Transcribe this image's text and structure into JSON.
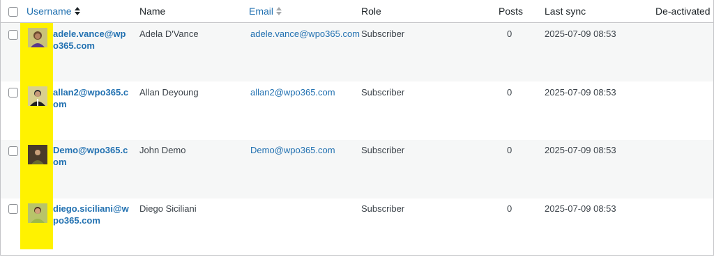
{
  "columns": {
    "username": "Username",
    "name": "Name",
    "email": "Email",
    "role": "Role",
    "posts": "Posts",
    "last_sync": "Last sync",
    "deactivated": "De-activated"
  },
  "colors": {
    "link": "#2271b1",
    "highlight": "#fff200",
    "alt_row": "#f6f7f7"
  },
  "users": [
    {
      "username": "adele.vance@wpo365.com",
      "name": "Adela D'Vance",
      "email": "adele.vance@wpo365.com",
      "role": "Subscriber",
      "posts": "0",
      "last_sync": "2025-07-09 08:53",
      "deactivated": "",
      "avatar": "avatar-photo-icon"
    },
    {
      "username": "allan2@wpo365.com",
      "name": "Allan Deyoung",
      "email": "allan2@wpo365.com",
      "role": "Subscriber",
      "posts": "0",
      "last_sync": "2025-07-09 08:53",
      "deactivated": "",
      "avatar": "avatar-photo-icon"
    },
    {
      "username": "Demo@wpo365.com",
      "name": "John Demo",
      "email": "Demo@wpo365.com",
      "role": "Subscriber",
      "posts": "0",
      "last_sync": "2025-07-09 08:53",
      "deactivated": "",
      "avatar": "avatar-photo-icon"
    },
    {
      "username": "diego.siciliani@wpo365.com",
      "name": "Diego Siciliani",
      "email": "",
      "role": "Subscriber",
      "posts": "0",
      "last_sync": "2025-07-09 08:53",
      "deactivated": "",
      "avatar": "avatar-photo-icon"
    }
  ]
}
